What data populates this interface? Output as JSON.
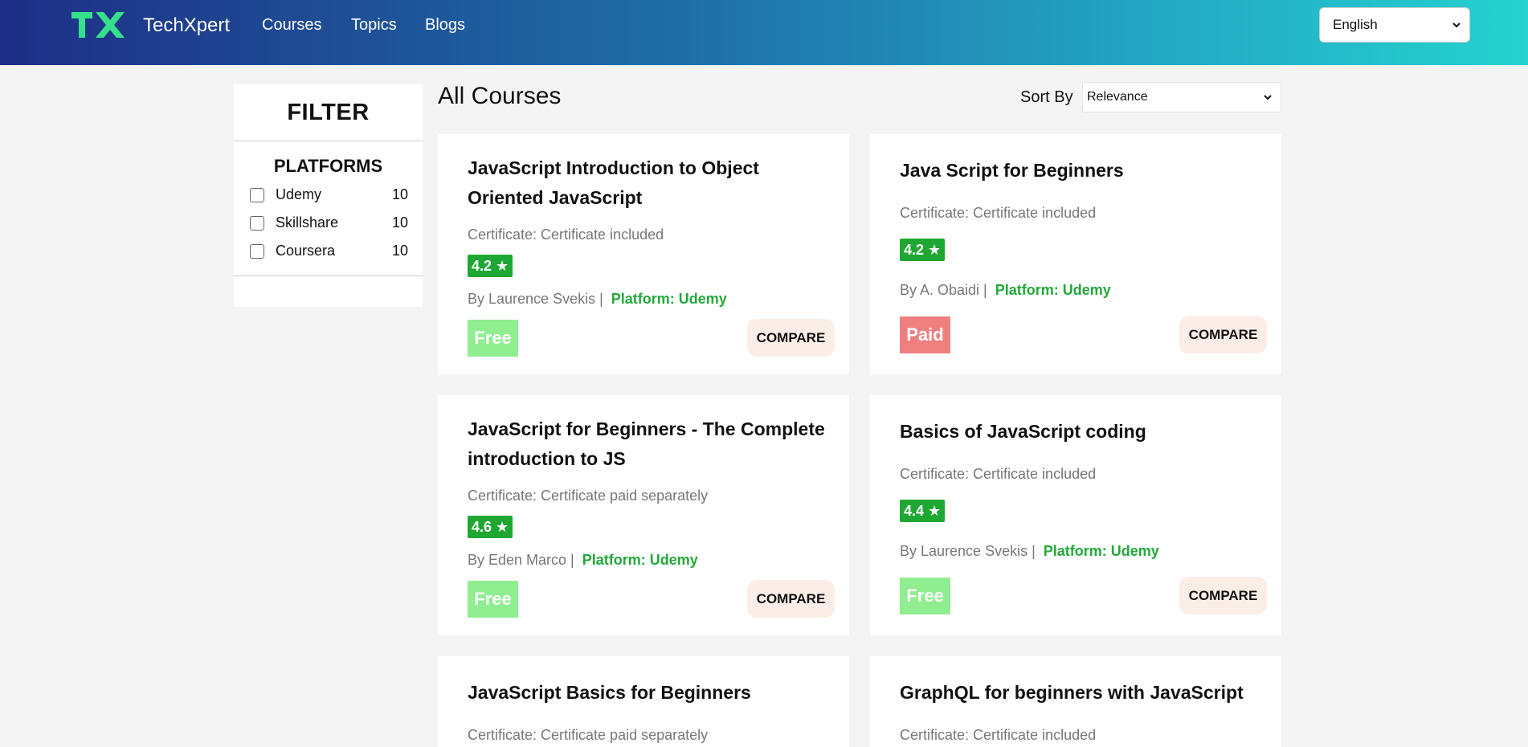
{
  "header": {
    "brand": "TechXpert",
    "nav": [
      "Courses",
      "Topics",
      "Blogs"
    ],
    "language": "English",
    "colors": {
      "logo": "#35e08c",
      "gradient_start": "#1d2e86",
      "gradient_end": "#25d3cf"
    }
  },
  "filter": {
    "title": "FILTER",
    "platforms_title": "PLATFORMS",
    "platforms": [
      {
        "name": "Udemy",
        "count": "10"
      },
      {
        "name": "Skillshare",
        "count": "10"
      },
      {
        "name": "Coursera",
        "count": "10"
      }
    ]
  },
  "main": {
    "title": "All Courses",
    "sort_label": "Sort By",
    "sort_value": "Relevance"
  },
  "courses": [
    {
      "title": "JavaScript Introduction to Object Oriented JavaScript",
      "certificate": "Certificate: Certificate included",
      "rating": "4.2 ★",
      "author": "By Laurence Svekis |",
      "platform": "Platform: Udemy",
      "price": "Free",
      "compare": "COMPARE"
    },
    {
      "title": "Java Script for Beginners",
      "certificate": "Certificate: Certificate included",
      "rating": "4.2 ★",
      "author": "By A. Obaidi |",
      "platform": "Platform: Udemy",
      "price": "Paid",
      "compare": "COMPARE"
    },
    {
      "title": "JavaScript for Beginners - The Complete introduction to JS",
      "certificate": "Certificate: Certificate paid separately",
      "rating": "4.6 ★",
      "author": "By Eden Marco |",
      "platform": "Platform: Udemy",
      "price": "Free",
      "compare": "COMPARE"
    },
    {
      "title": "Basics of JavaScript coding",
      "certificate": "Certificate: Certificate included",
      "rating": "4.4 ★",
      "author": "By Laurence Svekis |",
      "platform": "Platform: Udemy",
      "price": "Free",
      "compare": "COMPARE"
    },
    {
      "title": "JavaScript Basics for Beginners",
      "certificate": "Certificate: Certificate paid separately"
    },
    {
      "title": "GraphQL for beginners with JavaScript",
      "certificate": "Certificate: Certificate included"
    }
  ]
}
